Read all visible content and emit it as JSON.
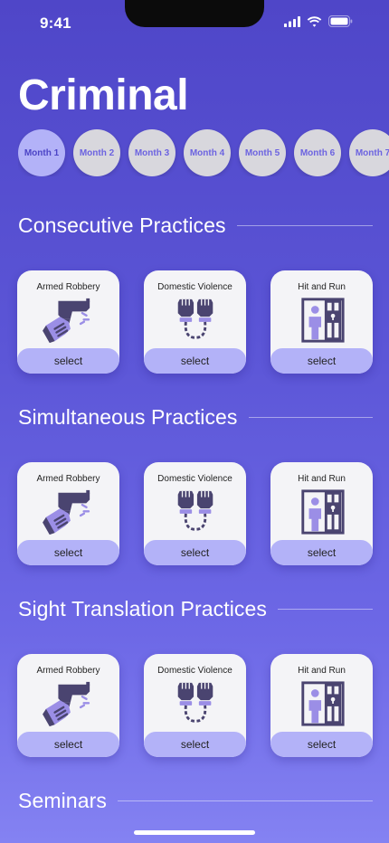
{
  "status_bar": {
    "time": "9:41"
  },
  "page": {
    "title": "Criminal"
  },
  "months": [
    "Month 1",
    "Month 2",
    "Month 3",
    "Month 4",
    "Month 5",
    "Month 6",
    "Month 7"
  ],
  "sections": [
    {
      "title": "Consecutive Practices",
      "cards": [
        {
          "title": "Armed Robbery",
          "icon": "gun-icon",
          "action": "select"
        },
        {
          "title": "Domestic Violence",
          "icon": "handcuffed-fists-icon",
          "action": "select"
        },
        {
          "title": "Hit and Run",
          "icon": "jail-cell-icon",
          "action": "select"
        }
      ]
    },
    {
      "title": "Simultaneous Practices",
      "cards": [
        {
          "title": "Armed Robbery",
          "icon": "gun-icon",
          "action": "select"
        },
        {
          "title": "Domestic Violence",
          "icon": "handcuffed-fists-icon",
          "action": "select"
        },
        {
          "title": "Hit and Run",
          "icon": "jail-cell-icon",
          "action": "select"
        }
      ]
    },
    {
      "title": "Sight Translation Practices",
      "cards": [
        {
          "title": "Armed Robbery",
          "icon": "gun-icon",
          "action": "select"
        },
        {
          "title": "Domestic Violence",
          "icon": "handcuffed-fists-icon",
          "action": "select"
        },
        {
          "title": "Hit and Run",
          "icon": "jail-cell-icon",
          "action": "select"
        }
      ]
    },
    {
      "title": "Seminars",
      "cards": []
    }
  ],
  "colors": {
    "accent": "#b3b2f8",
    "icon_dark": "#4a4470",
    "icon_light": "#9b8ee6"
  }
}
